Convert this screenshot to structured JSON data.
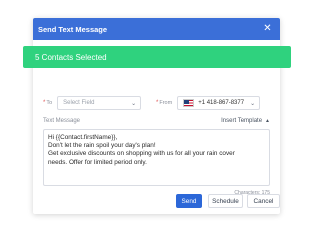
{
  "modal": {
    "title": "Send Text Message",
    "close_icon": "close-icon"
  },
  "banner": {
    "text": "5 Contacts Selected",
    "color": "#2fd27e"
  },
  "to_field": {
    "label": "To",
    "required_mark": "*",
    "placeholder": "Select Field"
  },
  "from_field": {
    "label": "From",
    "required_mark": "*",
    "flag_icon": "us-flag-icon",
    "value": "+1 418-867-8377"
  },
  "message": {
    "label": "Text Message",
    "insert_template": "Insert Template",
    "lines": [
      "Hi {{Contact.firstName}},",
      "Don't let the rain spoil your day's plan!",
      "Get exclusive discounts on shopping with us for all your rain cover",
      "needs. Offer for limited period only."
    ],
    "characters": "Characters: 175"
  },
  "actions": {
    "send": "Send",
    "schedule": "Schedule",
    "cancel": "Cancel"
  },
  "colors": {
    "header": "#3b6fd8",
    "primary_button": "#2c67d8",
    "required": "#e05252"
  }
}
